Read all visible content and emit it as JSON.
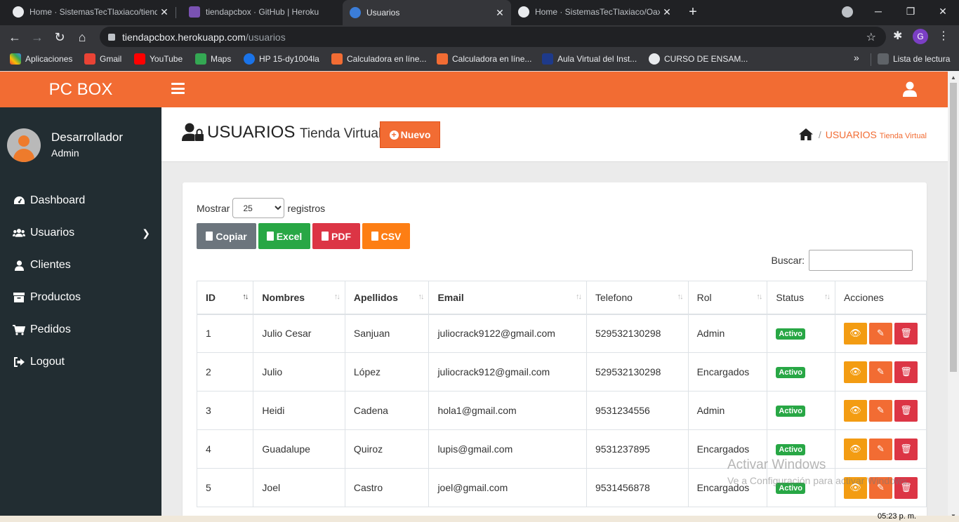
{
  "browser": {
    "tabs": [
      {
        "title": "Home · SistemasTecTlaxiaco/tienda",
        "favicon_color": "#e8eaed",
        "active": false
      },
      {
        "title": "tiendapcbox · GitHub | Heroku",
        "favicon_color": "#7a52b3",
        "active": false
      },
      {
        "title": "Usuarios",
        "favicon_color": "#3b7dd8",
        "active": true
      },
      {
        "title": "Home · SistemasTecTlaxiaco/Oax",
        "favicon_color": "#e8eaed",
        "active": false
      }
    ],
    "url_host": "tiendapcbox.herokuapp.com",
    "url_path": "/usuarios",
    "profile_initial": "G",
    "bookmarks": [
      {
        "label": "Aplicaciones",
        "color": "#ea4335"
      },
      {
        "label": "Gmail",
        "color": "#ea4335"
      },
      {
        "label": "YouTube",
        "color": "#ff0000"
      },
      {
        "label": "Maps",
        "color": "#34a853"
      },
      {
        "label": "HP 15-dy1004la",
        "color": "#1a73e8"
      },
      {
        "label": "Calculadora en líne...",
        "color": "#f26c33"
      },
      {
        "label": "Calculadora en líne...",
        "color": "#f26c33"
      },
      {
        "label": "Aula Virtual del Inst...",
        "color": "#1e3a8a"
      },
      {
        "label": "CURSO DE ENSAM...",
        "color": "#e8eaed"
      }
    ],
    "reading_list": "Lista de lectura"
  },
  "app": {
    "brand": "PC BOX",
    "accent": "#f26c33",
    "sidebar_bg": "#222d32",
    "user": {
      "name": "Desarrollador",
      "role": "Admin"
    },
    "menu": [
      {
        "label": "Dashboard",
        "icon": "dashboard-icon"
      },
      {
        "label": "Usuarios",
        "icon": "users-icon",
        "has_children": true
      },
      {
        "label": "Clientes",
        "icon": "user-icon"
      },
      {
        "label": "Productos",
        "icon": "archive-icon"
      },
      {
        "label": "Pedidos",
        "icon": "cart-icon"
      },
      {
        "label": "Logout",
        "icon": "sign-out-icon"
      }
    ],
    "header": {
      "title": "USUARIOS",
      "subtitle": "Tienda Virtual",
      "new_button": "Nuevo",
      "breadcrumb_current": "USUARIOS",
      "breadcrumb_sub": "Tienda Virtual"
    },
    "table_controls": {
      "show_label": "Mostrar",
      "show_value": "25",
      "records_label": "registros",
      "search_label": "Buscar:",
      "buttons": [
        {
          "label": "Copiar",
          "color": "#6c757d"
        },
        {
          "label": "Excel",
          "color": "#28a745"
        },
        {
          "label": "PDF",
          "color": "#dc3545"
        },
        {
          "label": "CSV",
          "color": "#fd7e14"
        }
      ]
    },
    "columns": [
      "ID",
      "Nombres",
      "Apellidos",
      "Email",
      "Telefono",
      "Rol",
      "Status",
      "Acciones"
    ],
    "rows": [
      {
        "id": "1",
        "nombres": "Julio Cesar",
        "apellidos": "Sanjuan",
        "email": "juliocrack9122@gmail.com",
        "telefono": "529532130298",
        "rol": "Admin",
        "status": "Activo"
      },
      {
        "id": "2",
        "nombres": "Julio",
        "apellidos": "López",
        "email": "juliocrack912@gmail.com",
        "telefono": "529532130298",
        "rol": "Encargados",
        "status": "Activo"
      },
      {
        "id": "3",
        "nombres": "Heidi",
        "apellidos": "Cadena",
        "email": "hola1@gmail.com",
        "telefono": "9531234556",
        "rol": "Admin",
        "status": "Activo"
      },
      {
        "id": "4",
        "nombres": "Guadalupe",
        "apellidos": "Quiroz",
        "email": "lupis@gmail.com",
        "telefono": "9531237895",
        "rol": "Encargados",
        "status": "Activo"
      },
      {
        "id": "5",
        "nombres": "Joel",
        "apellidos": "Castro",
        "email": "joel@gmail.com",
        "telefono": "9531456878",
        "rol": "Encargados",
        "status": "Activo"
      }
    ],
    "action_colors": {
      "view": "#f39c12",
      "edit": "#f26c33",
      "delete": "#dc3545"
    }
  },
  "watermark": {
    "line1": "Activar Windows",
    "line2": "Ve a Configuración para activar Windows."
  },
  "clock": "05:23 p. m."
}
